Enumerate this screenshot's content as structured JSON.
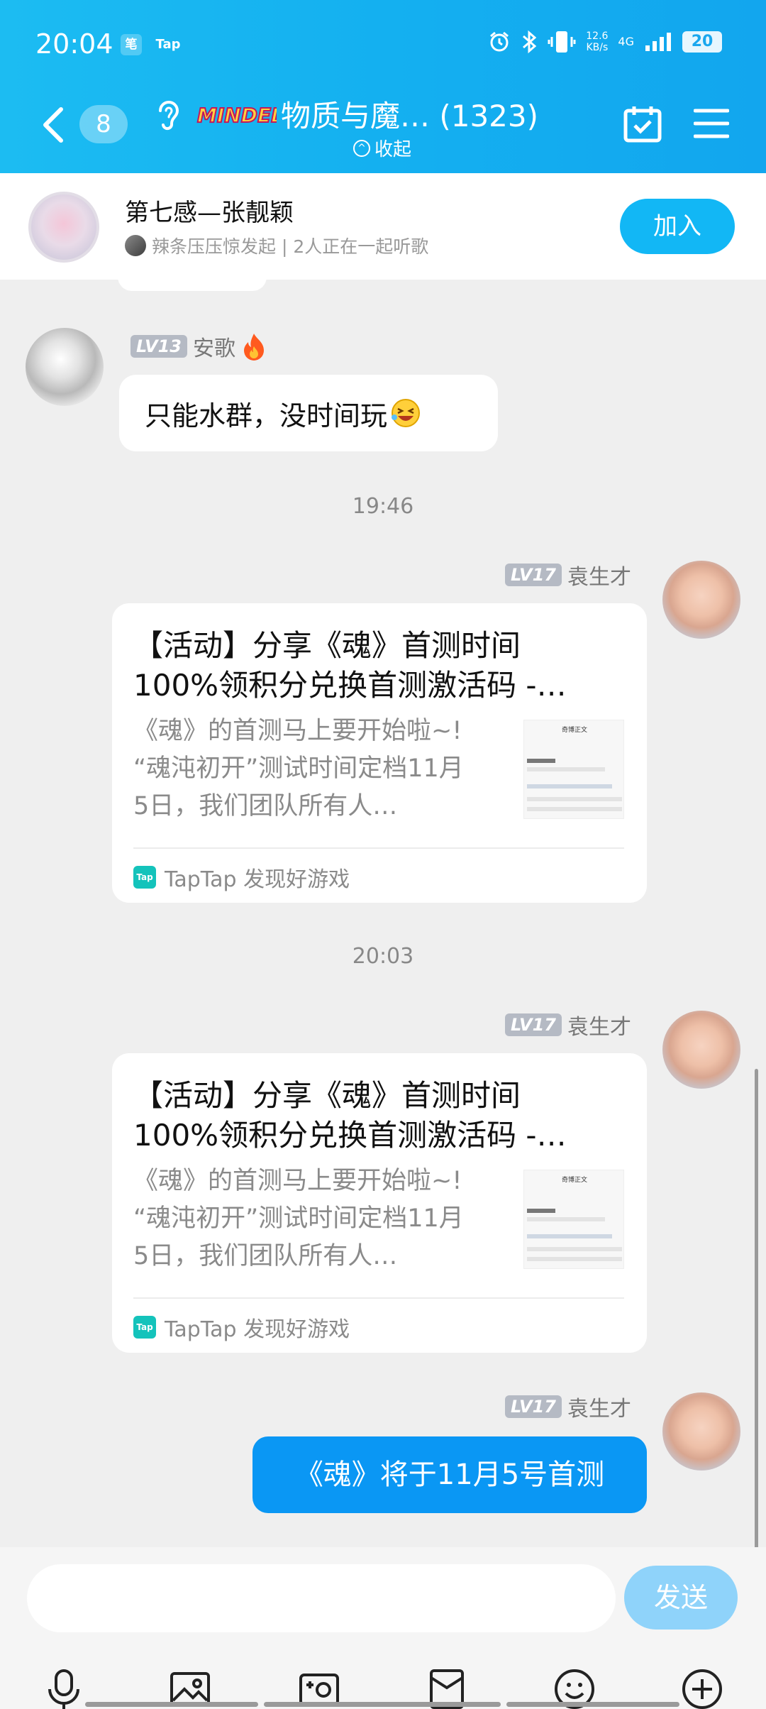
{
  "status_bar": {
    "time": "20:04",
    "app1": "笔",
    "app2": "Tap",
    "net_speed": "12.6",
    "net_unit": "KB/s",
    "network": "4G",
    "battery": "20"
  },
  "header": {
    "unread_count": "8",
    "logo_text": "MINDED",
    "group_title": "物质与魔… (1323)",
    "collapse_label": "收起"
  },
  "listen_banner": {
    "song_title": "第七感—张靓颖",
    "subtitle": "辣条压压惊发起 | 2人正在一起听歌",
    "join_label": "加入"
  },
  "messages": {
    "ange": {
      "level": "LV13",
      "name": "安歌",
      "text": "只能水群，没时间玩"
    },
    "time1": "19:46",
    "time2": "20:03",
    "yuan": {
      "level": "LV17",
      "name": "袁生才"
    },
    "card": {
      "title_line1": "【活动】分享《魂》首测时间",
      "title_line2": "100%领积分兑换首测激活码 -…",
      "desc_line1": "《魂》的首测马上要开始啦~!",
      "desc_line2": "“魂沌初开”测试时间定档11月",
      "desc_line3": "5日，我们团队所有人…",
      "thumb_title": "奇博正文",
      "source": "TapTap 发现好游戏",
      "tap_logo": "Tap"
    },
    "last_text": "《魂》将于11月5号首测"
  },
  "input": {
    "placeholder": "",
    "send_label": "发送"
  },
  "icons": {
    "back": "chevron-left-icon",
    "listen": "ear-icon",
    "checkin": "calendar-check-icon",
    "menu": "hamburger-menu-icon",
    "fire": "fire-icon",
    "emoji": "laughing-emoji-icon",
    "toolbar": [
      "microphone-icon",
      "image-icon",
      "camera-icon",
      "red-packet-icon",
      "emoji-icon",
      "plus-icon"
    ]
  },
  "colors": {
    "header_gradient_start": "#1cbcf2",
    "header_gradient_end": "#12a6ee",
    "accent": "#12b7f5",
    "own_bubble": "#0a97f4",
    "send_button": "#8fd3fa",
    "level_badge": "#b5bac4"
  }
}
